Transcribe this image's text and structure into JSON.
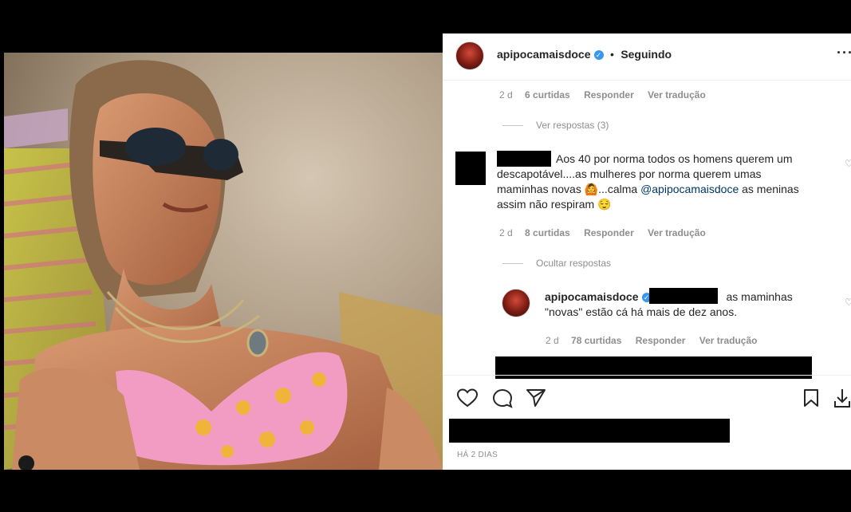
{
  "post": {
    "username": "apipocamaisdoce",
    "follow_status": "Seguindo",
    "more_menu": "...",
    "date_label": "HÁ 2 DIAS"
  },
  "comments": [
    {
      "id": "prev",
      "time": "2 d",
      "likes": "6 curtidas",
      "reply": "Responder",
      "translate": "Ver tradução",
      "replies_toggle": "Ver respostas (3)"
    },
    {
      "id": "main",
      "text_1": "Aos 40 por norma todos os homens querem um",
      "text_2": "descapotável....as mulheres por norma querem umas",
      "text_3a": "maminhas novas ",
      "emoji_1": "🙆",
      "text_3b": "...calma ",
      "mention": "@apipocamaisdoce",
      "text_3c": " as meninas",
      "text_4": "assim não respiram ",
      "emoji_2": "😌",
      "time": "2 d",
      "likes": "8 curtidas",
      "reply": "Responder",
      "translate": "Ver tradução",
      "replies_toggle": "Ocultar respostas"
    },
    {
      "id": "reply",
      "username": "apipocamaisdoce",
      "text_1": "as maminhas",
      "text_2": "\"novas\" estão cá há mais de dez anos.",
      "time": "2 d",
      "likes": "78 curtidas",
      "reply": "Responder",
      "translate": "Ver tradução"
    }
  ],
  "colors": {
    "verified": "#3897f0",
    "mention": "#00376b",
    "muted": "#8e8e8e"
  }
}
